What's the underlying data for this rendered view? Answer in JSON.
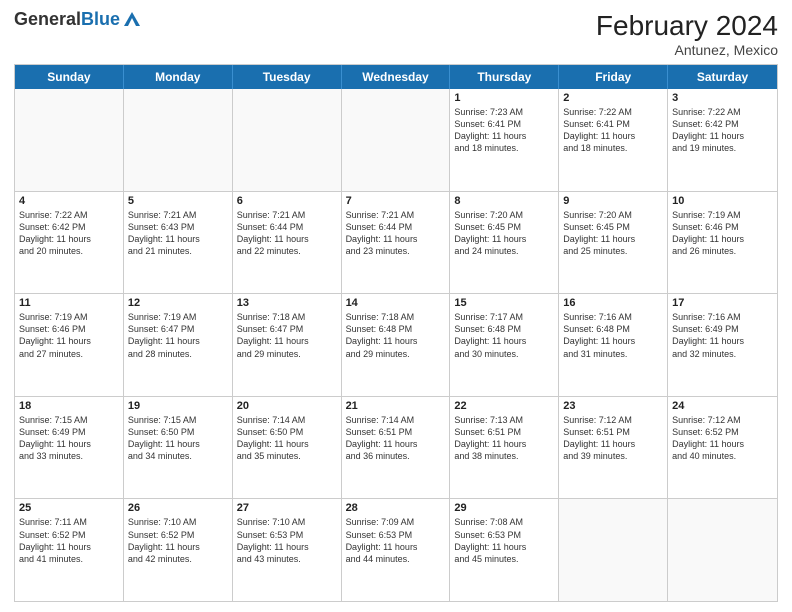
{
  "header": {
    "logo_general": "General",
    "logo_blue": "Blue",
    "month_title": "February 2024",
    "location": "Antunez, Mexico"
  },
  "weekdays": [
    "Sunday",
    "Monday",
    "Tuesday",
    "Wednesday",
    "Thursday",
    "Friday",
    "Saturday"
  ],
  "rows": [
    [
      {
        "day": "",
        "info": ""
      },
      {
        "day": "",
        "info": ""
      },
      {
        "day": "",
        "info": ""
      },
      {
        "day": "",
        "info": ""
      },
      {
        "day": "1",
        "info": "Sunrise: 7:23 AM\nSunset: 6:41 PM\nDaylight: 11 hours\nand 18 minutes."
      },
      {
        "day": "2",
        "info": "Sunrise: 7:22 AM\nSunset: 6:41 PM\nDaylight: 11 hours\nand 18 minutes."
      },
      {
        "day": "3",
        "info": "Sunrise: 7:22 AM\nSunset: 6:42 PM\nDaylight: 11 hours\nand 19 minutes."
      }
    ],
    [
      {
        "day": "4",
        "info": "Sunrise: 7:22 AM\nSunset: 6:42 PM\nDaylight: 11 hours\nand 20 minutes."
      },
      {
        "day": "5",
        "info": "Sunrise: 7:21 AM\nSunset: 6:43 PM\nDaylight: 11 hours\nand 21 minutes."
      },
      {
        "day": "6",
        "info": "Sunrise: 7:21 AM\nSunset: 6:44 PM\nDaylight: 11 hours\nand 22 minutes."
      },
      {
        "day": "7",
        "info": "Sunrise: 7:21 AM\nSunset: 6:44 PM\nDaylight: 11 hours\nand 23 minutes."
      },
      {
        "day": "8",
        "info": "Sunrise: 7:20 AM\nSunset: 6:45 PM\nDaylight: 11 hours\nand 24 minutes."
      },
      {
        "day": "9",
        "info": "Sunrise: 7:20 AM\nSunset: 6:45 PM\nDaylight: 11 hours\nand 25 minutes."
      },
      {
        "day": "10",
        "info": "Sunrise: 7:19 AM\nSunset: 6:46 PM\nDaylight: 11 hours\nand 26 minutes."
      }
    ],
    [
      {
        "day": "11",
        "info": "Sunrise: 7:19 AM\nSunset: 6:46 PM\nDaylight: 11 hours\nand 27 minutes."
      },
      {
        "day": "12",
        "info": "Sunrise: 7:19 AM\nSunset: 6:47 PM\nDaylight: 11 hours\nand 28 minutes."
      },
      {
        "day": "13",
        "info": "Sunrise: 7:18 AM\nSunset: 6:47 PM\nDaylight: 11 hours\nand 29 minutes."
      },
      {
        "day": "14",
        "info": "Sunrise: 7:18 AM\nSunset: 6:48 PM\nDaylight: 11 hours\nand 29 minutes."
      },
      {
        "day": "15",
        "info": "Sunrise: 7:17 AM\nSunset: 6:48 PM\nDaylight: 11 hours\nand 30 minutes."
      },
      {
        "day": "16",
        "info": "Sunrise: 7:16 AM\nSunset: 6:48 PM\nDaylight: 11 hours\nand 31 minutes."
      },
      {
        "day": "17",
        "info": "Sunrise: 7:16 AM\nSunset: 6:49 PM\nDaylight: 11 hours\nand 32 minutes."
      }
    ],
    [
      {
        "day": "18",
        "info": "Sunrise: 7:15 AM\nSunset: 6:49 PM\nDaylight: 11 hours\nand 33 minutes."
      },
      {
        "day": "19",
        "info": "Sunrise: 7:15 AM\nSunset: 6:50 PM\nDaylight: 11 hours\nand 34 minutes."
      },
      {
        "day": "20",
        "info": "Sunrise: 7:14 AM\nSunset: 6:50 PM\nDaylight: 11 hours\nand 35 minutes."
      },
      {
        "day": "21",
        "info": "Sunrise: 7:14 AM\nSunset: 6:51 PM\nDaylight: 11 hours\nand 36 minutes."
      },
      {
        "day": "22",
        "info": "Sunrise: 7:13 AM\nSunset: 6:51 PM\nDaylight: 11 hours\nand 38 minutes."
      },
      {
        "day": "23",
        "info": "Sunrise: 7:12 AM\nSunset: 6:51 PM\nDaylight: 11 hours\nand 39 minutes."
      },
      {
        "day": "24",
        "info": "Sunrise: 7:12 AM\nSunset: 6:52 PM\nDaylight: 11 hours\nand 40 minutes."
      }
    ],
    [
      {
        "day": "25",
        "info": "Sunrise: 7:11 AM\nSunset: 6:52 PM\nDaylight: 11 hours\nand 41 minutes."
      },
      {
        "day": "26",
        "info": "Sunrise: 7:10 AM\nSunset: 6:52 PM\nDaylight: 11 hours\nand 42 minutes."
      },
      {
        "day": "27",
        "info": "Sunrise: 7:10 AM\nSunset: 6:53 PM\nDaylight: 11 hours\nand 43 minutes."
      },
      {
        "day": "28",
        "info": "Sunrise: 7:09 AM\nSunset: 6:53 PM\nDaylight: 11 hours\nand 44 minutes."
      },
      {
        "day": "29",
        "info": "Sunrise: 7:08 AM\nSunset: 6:53 PM\nDaylight: 11 hours\nand 45 minutes."
      },
      {
        "day": "",
        "info": ""
      },
      {
        "day": "",
        "info": ""
      }
    ]
  ]
}
